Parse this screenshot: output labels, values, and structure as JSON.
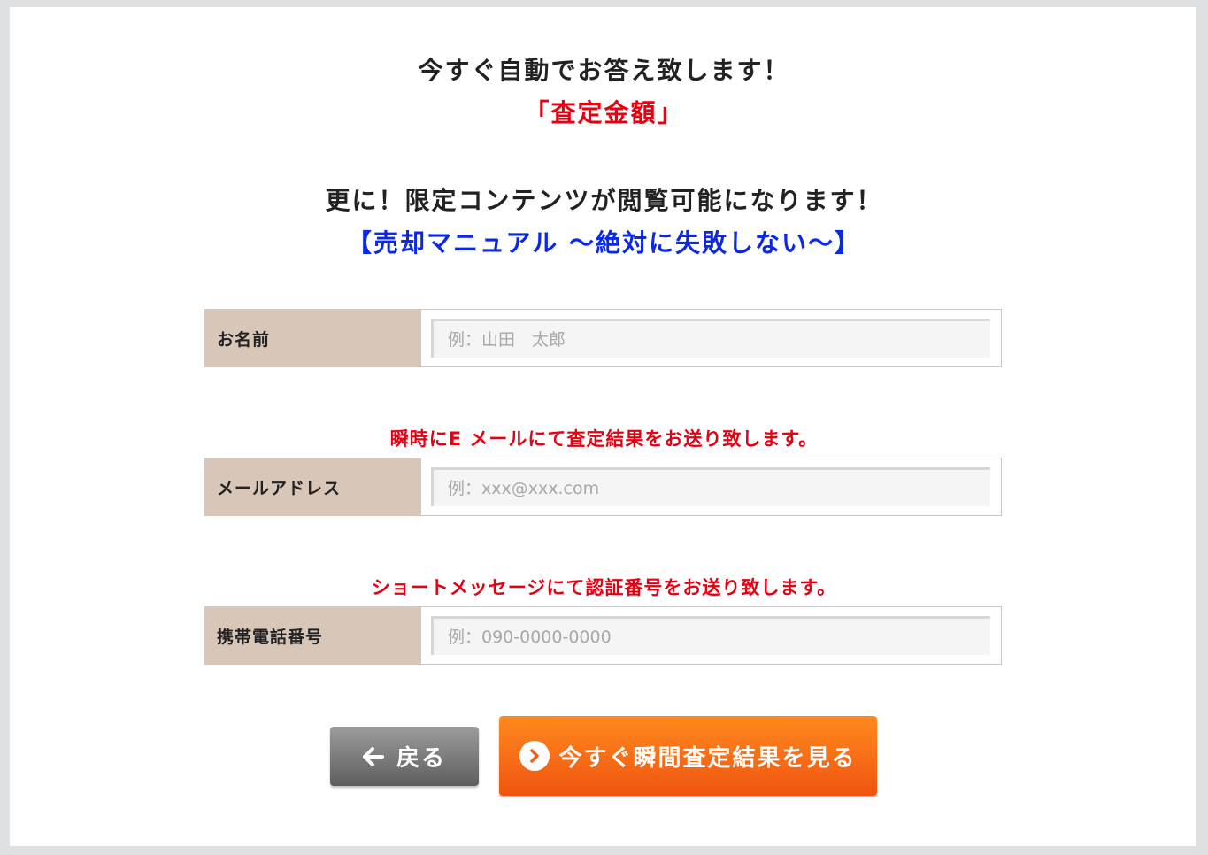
{
  "headings": {
    "line1": "今すぐ自動でお答え致します！",
    "line2": "「査定金額」",
    "line3": "更に！限定コンテンツが閲覧可能になります！",
    "line4": "【売却マニュアル 〜絶対に失敗しない〜】"
  },
  "form": {
    "name": {
      "label": "お名前",
      "placeholder": "例：山田　太郎",
      "value": ""
    },
    "email": {
      "notice": "瞬時にE メールにて査定結果をお送り致します。",
      "label": "メールアドレス",
      "placeholder": "例：xxx@xxx.com",
      "value": ""
    },
    "phone": {
      "notice": "ショートメッセージにて認証番号をお送り致します。",
      "label": "携帯電話番号",
      "placeholder": "例：090-0000-0000",
      "value": ""
    }
  },
  "buttons": {
    "back_label": "戻る",
    "back_icon": "arrow-left-icon",
    "submit_label": "今すぐ瞬間査定結果を見る",
    "submit_icon": "chevron-right-circle-icon"
  },
  "colors": {
    "label_bg": "#d8c6b8",
    "notice_red": "#e60012",
    "highlight_blue": "#0a28e6",
    "submit_orange": "#f47216",
    "back_gray": "#7d7d7d"
  }
}
